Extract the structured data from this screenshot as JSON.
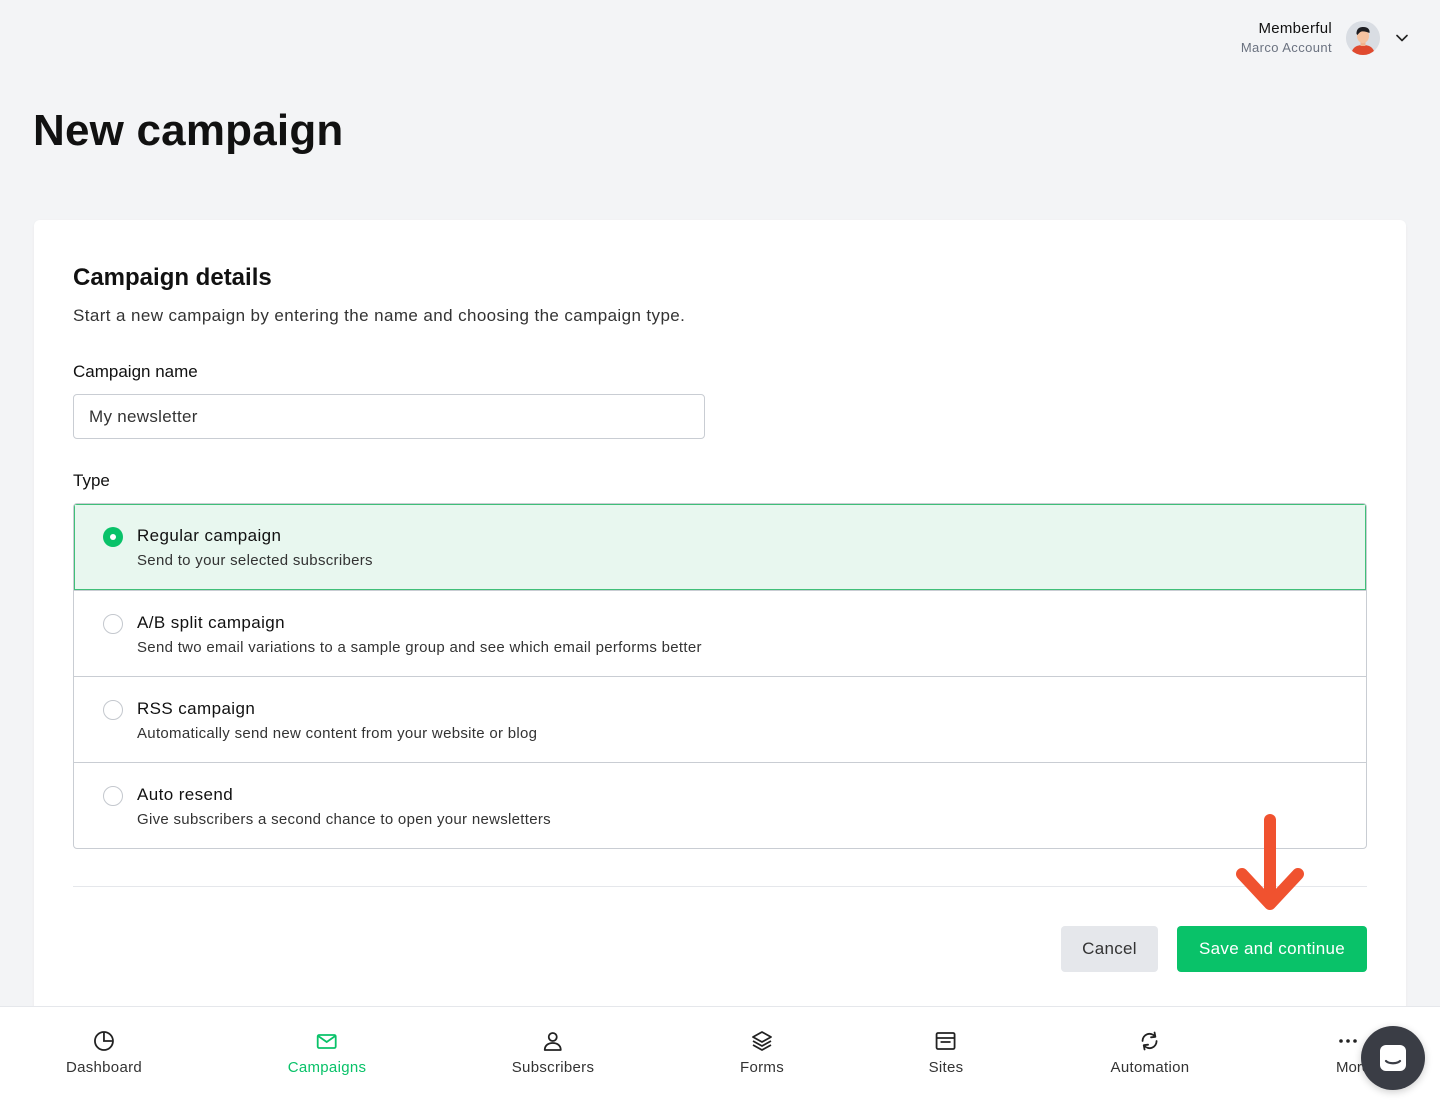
{
  "account": {
    "org": "Memberful",
    "user": "Marco Account"
  },
  "page": {
    "title": "New campaign"
  },
  "details": {
    "title": "Campaign details",
    "description": "Start a new campaign by entering the name and choosing the campaign type.",
    "name_label": "Campaign name",
    "name_value": "My newsletter",
    "type_label": "Type"
  },
  "types": [
    {
      "title": "Regular campaign",
      "desc": "Send to your selected subscribers",
      "selected": true
    },
    {
      "title": "A/B split campaign",
      "desc": "Send two email variations to a sample group and see which email performs better",
      "selected": false
    },
    {
      "title": "RSS campaign",
      "desc": "Automatically send new content from your website or blog",
      "selected": false
    },
    {
      "title": "Auto resend",
      "desc": "Give subscribers a second chance to open your newsletters",
      "selected": false
    }
  ],
  "actions": {
    "cancel": "Cancel",
    "save": "Save and continue"
  },
  "nav": {
    "items": [
      {
        "label": "Dashboard",
        "icon": "pie-chart-icon",
        "active": false
      },
      {
        "label": "Campaigns",
        "icon": "envelope-icon",
        "active": true
      },
      {
        "label": "Subscribers",
        "icon": "user-icon",
        "active": false
      },
      {
        "label": "Forms",
        "icon": "layers-icon",
        "active": false
      },
      {
        "label": "Sites",
        "icon": "browser-window-icon",
        "active": false
      },
      {
        "label": "Automation",
        "icon": "refresh-icon",
        "active": false
      }
    ],
    "more": "More"
  },
  "colors": {
    "accent": "#09c269",
    "selected_bg": "#e8f7ef",
    "annotation_arrow": "#f0522f",
    "chat_bubble": "#3a3d45"
  }
}
